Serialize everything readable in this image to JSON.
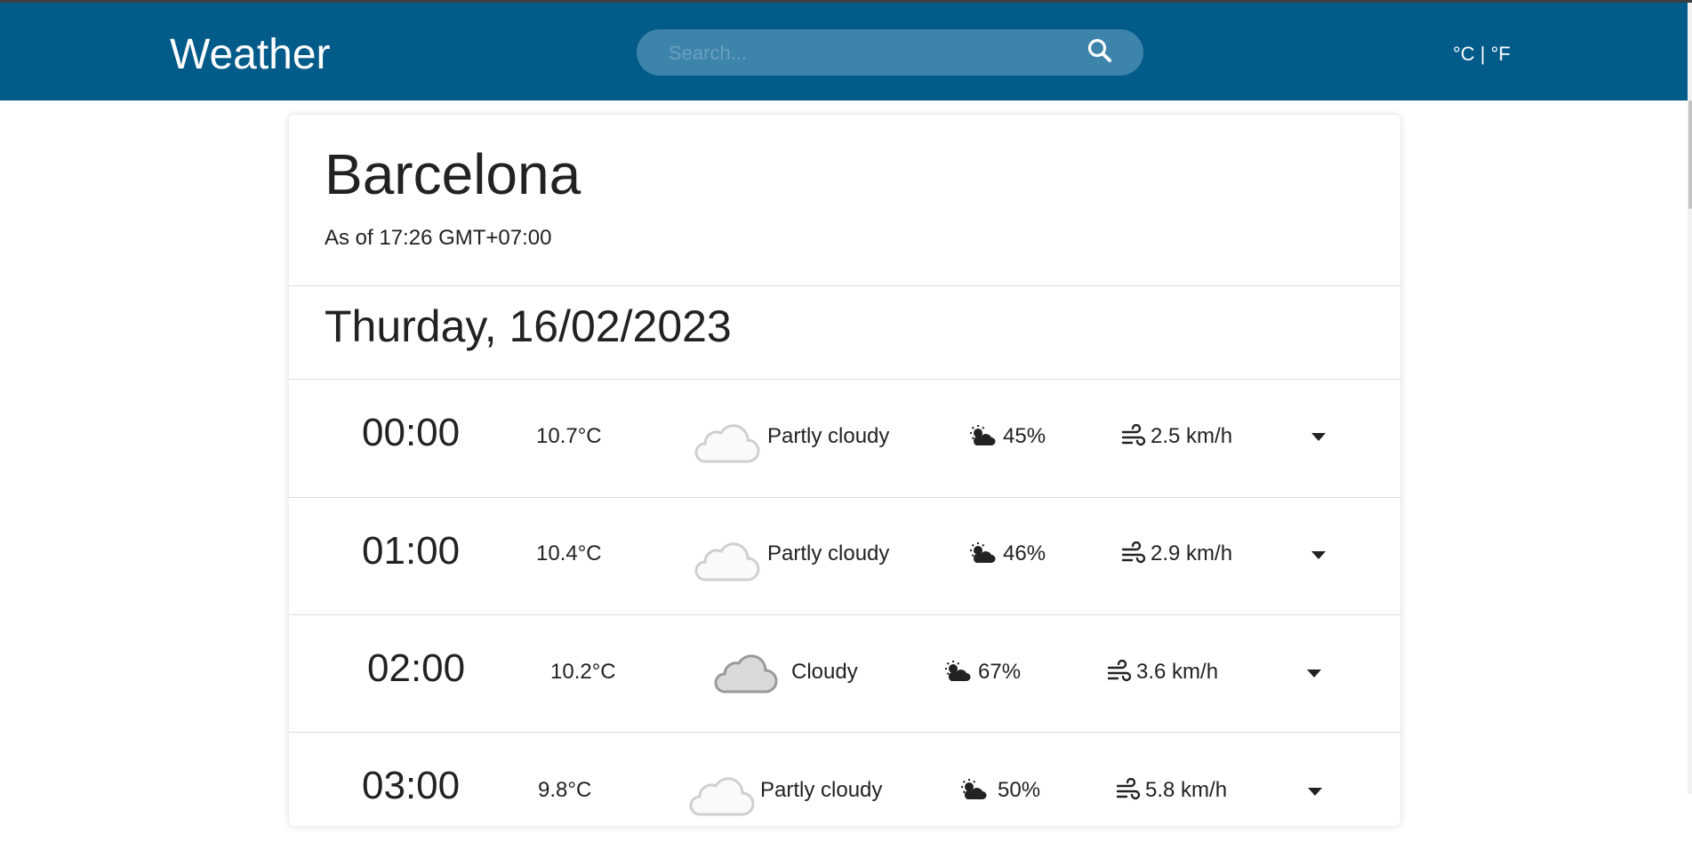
{
  "header": {
    "brand": "Weather",
    "search_placeholder": "Search...",
    "search_value": "",
    "unit_toggle": "°C | °F",
    "bar_color": "#035b8a"
  },
  "location": {
    "city": "Barcelona",
    "as_of": "As of 17:26 GMT+07:00"
  },
  "day": {
    "title": "Thurday, 16/02/2023"
  },
  "hours": [
    {
      "time": "00:00",
      "temp": "10.7°C",
      "condition": "Partly cloudy",
      "icon": "moon-partly-cloudy-icon",
      "humidity": "45%",
      "wind": "2.5 km/h"
    },
    {
      "time": "01:00",
      "temp": "10.4°C",
      "condition": "Partly cloudy",
      "icon": "moon-partly-cloudy-icon",
      "humidity": "46%",
      "wind": "2.9 km/h"
    },
    {
      "time": "02:00",
      "temp": "10.2°C",
      "condition": "Cloudy",
      "icon": "moon-cloudy-icon",
      "humidity": "67%",
      "wind": "3.6 km/h"
    },
    {
      "time": "03:00",
      "temp": "9.8°C",
      "condition": "Partly cloudy",
      "icon": "moon-partly-cloudy-icon",
      "humidity": "50%",
      "wind": "5.8 km/h"
    }
  ]
}
